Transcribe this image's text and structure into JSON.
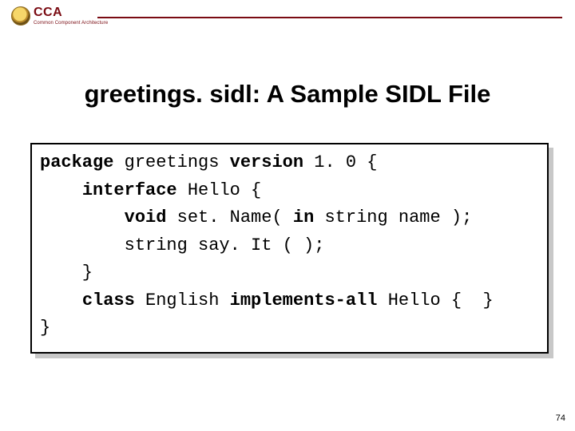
{
  "header": {
    "acronym": "CCA",
    "subtitle": "Common Component Architecture"
  },
  "title": "greetings. sidl: A Sample SIDL File",
  "code": {
    "l1": {
      "kw_package": "package",
      "pkg": " greetings ",
      "kw_version": "version",
      "ver": " 1. 0 {"
    },
    "l2": {
      "indent": "    ",
      "kw_interface": "interface",
      "name": " Hello {"
    },
    "l3": {
      "indent": "        ",
      "kw_void": "void",
      "set": " set. Name( ",
      "kw_in": "in",
      "rest": " string name );"
    },
    "l4": "        string say. It ( );",
    "l5": "    }",
    "l6": {
      "indent": "    ",
      "kw_class": "class",
      "cls": " English ",
      "kw_impl": "implements-all",
      "tail": " Hello {  }"
    },
    "l7": "}"
  },
  "page_number": "74"
}
